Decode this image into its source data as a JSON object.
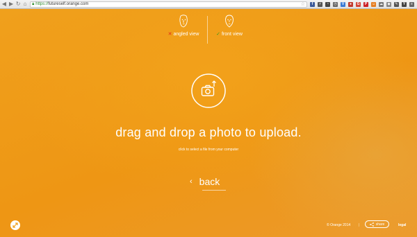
{
  "browser": {
    "url_scheme": "https://",
    "url_rest": "futureself.orange.com",
    "star": "☆",
    "extensions": [
      {
        "icon": "extension-icon",
        "glyph": "f",
        "color": "#3b5998"
      },
      {
        "icon": "extension-icon",
        "glyph": "⚡",
        "color": "#555555"
      },
      {
        "icon": "extension-icon",
        "glyph": "◔",
        "color": "#444444"
      },
      {
        "icon": "extension-icon",
        "glyph": "◷",
        "color": "#666666"
      },
      {
        "icon": "extension-icon",
        "glyph": "V",
        "color": "#3a7bd5"
      },
      {
        "icon": "extension-icon",
        "glyph": "●",
        "color": "#c0392b"
      },
      {
        "icon": "extension-icon",
        "glyph": "G",
        "color": "#d44638"
      },
      {
        "icon": "extension-icon",
        "glyph": "P",
        "color": "#cc2127"
      },
      {
        "icon": "extension-icon",
        "glyph": "☺",
        "color": "#e67e22"
      },
      {
        "icon": "extension-icon",
        "glyph": "☁",
        "color": "#777777"
      },
      {
        "icon": "extension-icon",
        "glyph": "◆",
        "color": "#888888"
      },
      {
        "icon": "extension-icon",
        "glyph": "✎",
        "color": "#555555"
      },
      {
        "icon": "extension-icon",
        "glyph": "Y",
        "color": "#444444"
      },
      {
        "icon": "menu-icon",
        "glyph": "≡",
        "color": "#666666"
      }
    ]
  },
  "views": {
    "angled": {
      "mark": "✕",
      "label": "angled view"
    },
    "front": {
      "mark": "✓",
      "label": "front view"
    }
  },
  "upload": {
    "headline": "drag and drop a photo to upload.",
    "subline": "click to select a file from your computer"
  },
  "back": {
    "chevron": "‹",
    "label": "back"
  },
  "footer": {
    "copyright": "© Orange 2014",
    "separator": "|",
    "share": "share",
    "legal": "legal"
  },
  "colors": {
    "accent": "#f0a01c",
    "cross": "#e0281a",
    "check": "#3a9a1e"
  }
}
